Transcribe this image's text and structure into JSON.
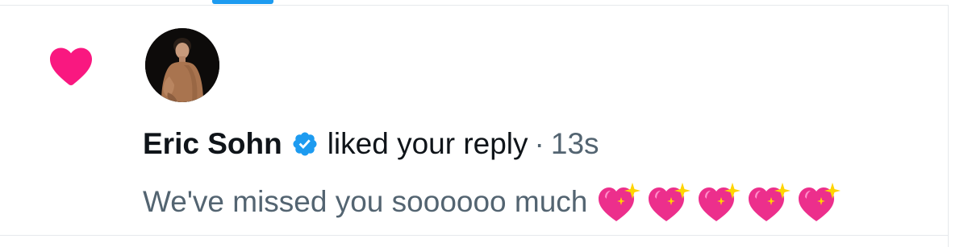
{
  "notification": {
    "type_icon": "heart-icon",
    "actor": {
      "name": "Eric Sohn",
      "verified": true,
      "verified_icon": "verified-badge-icon",
      "avatar": "avatar-photo"
    },
    "action": "liked your reply",
    "separator": "·",
    "timestamp": "13s",
    "reply_text": "We've missed you soooooo much",
    "emoji_icon": "sparkling-heart-icon",
    "emoji_count": 5
  },
  "colors": {
    "like_pink": "#f91880",
    "verified_blue": "#1d9bf0",
    "primary_text": "#0f1419",
    "secondary_text": "#536471",
    "divider": "#e6e9ec"
  }
}
